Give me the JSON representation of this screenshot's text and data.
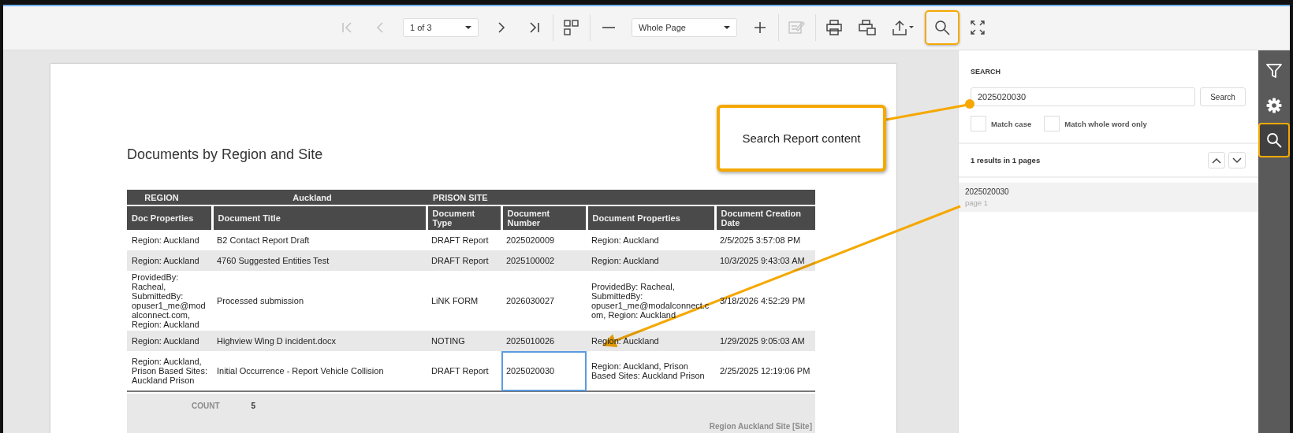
{
  "toolbar": {
    "first_page_button": {
      "disabled": true
    },
    "prev_page_button": {
      "disabled": true
    },
    "page_select": {
      "value": "1 of 3"
    },
    "next_page_button": {
      "disabled": false
    },
    "last_page_button": {
      "disabled": false
    },
    "zoom_select": {
      "value": "Whole Page"
    },
    "edit_button": {
      "disabled": true
    },
    "search_button": {
      "highlighted": true
    }
  },
  "report": {
    "title": "Documents by Region and Site",
    "group_header": [
      "REGION",
      "Auckland",
      "PRISON SITE"
    ],
    "columns": [
      {
        "label": "Doc Properties",
        "kind": "text"
      },
      {
        "label": "Document Title",
        "kind": "text"
      },
      {
        "label": "Document Type",
        "kind": "text"
      },
      {
        "label": "Document Number",
        "kind": "number"
      },
      {
        "label": "Document Properties",
        "kind": "text"
      },
      {
        "label": "Document Creation Date",
        "kind": "text"
      }
    ],
    "rows": [
      {
        "match": false,
        "cells": [
          "Region: Auckland",
          "B2 Contact Report Draft",
          "DRAFT Report",
          "2025020009",
          "Region: Auckland",
          "2/5/2025 3:57:08 PM"
        ]
      },
      {
        "match": false,
        "cells": [
          "Region: Auckland",
          "4760 Suggested Entities Test",
          "DRAFT Report",
          "2025100002",
          "Region: Auckland",
          "10/3/2025 9:43:03 AM"
        ]
      },
      {
        "match": false,
        "cells": [
          "ProvidedBy: Racheal, SubmittedBy: opuser1_me@modalconnect.com, Region: Auckland",
          "Processed submission",
          "LiNK FORM",
          "2026030027",
          "ProvidedBy: Racheal, SubmittedBy: opuser1_me@modalconnect.com, Region: Auckland",
          "3/18/2026 4:52:29 PM"
        ]
      },
      {
        "match": false,
        "cells": [
          "Region: Auckland",
          "Highview Wing D incident.docx",
          "NOTING",
          "2025010026",
          "Region: Auckland",
          "1/29/2025 9:05:03 AM"
        ]
      },
      {
        "match": true,
        "cells": [
          "Region: Auckland, Prison Based Sites: Auckland Prison",
          "Initial Occurrence - Report Vehicle Collision",
          "DRAFT Report",
          "2025020030",
          "Region: Auckland, Prison Based Sites: Auckland Prison",
          "2/25/2025 12:19:06 PM"
        ]
      }
    ],
    "count_label": "COUNT",
    "count_value": "5",
    "group_footer": "Region Auckland  Site [Site]"
  },
  "search_panel": {
    "heading": "SEARCH",
    "value": "2025020030",
    "button": "Search",
    "options": [
      {
        "label": "Match case",
        "checked": false
      },
      {
        "label": "Match whole word only",
        "checked": false
      }
    ],
    "summary": "1 results in 1 pages",
    "results": [
      {
        "text": "2025020030",
        "page": "page 1",
        "selected": true
      }
    ]
  },
  "sidebar_tabs": [
    {
      "selected": false,
      "highlighted": false
    },
    {
      "selected": false,
      "highlighted": false
    },
    {
      "selected": true,
      "highlighted": true
    }
  ],
  "callout": {
    "text": "Search Report content"
  }
}
